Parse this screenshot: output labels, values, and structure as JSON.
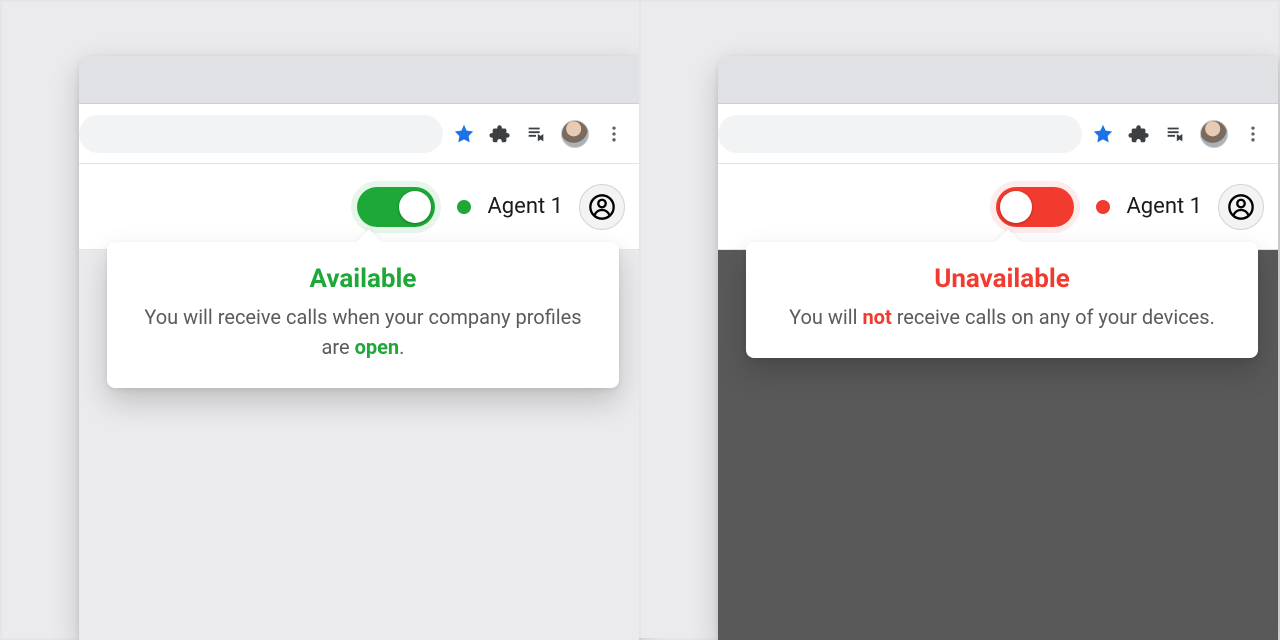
{
  "colors": {
    "green": "#1ea838",
    "red": "#f23b2f"
  },
  "left": {
    "agent_label": "Agent 1",
    "status": "available",
    "popover": {
      "title": "Available",
      "desc_before": "You will receive calls when your company profiles are ",
      "emphasis": "open",
      "desc_after": "."
    }
  },
  "right": {
    "agent_label": "Agent 1",
    "status": "unavailable",
    "popover": {
      "title": "Unavailable",
      "desc_before": "You will ",
      "emphasis": "not",
      "desc_after": " receive calls on any of your devices."
    }
  }
}
